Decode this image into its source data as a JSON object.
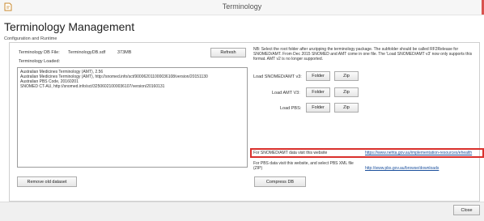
{
  "window": {
    "title": "Terminology",
    "accent_color": "#d9534f"
  },
  "page": {
    "title": "Terminology Management",
    "section_label": "Configuration and Runtime"
  },
  "db": {
    "file_label": "Terminology DB File:",
    "file_name": "TerminologyDB.sdf",
    "file_size": "373MB",
    "refresh_label": "Refresh",
    "loaded_label": "Terminology Loaded:"
  },
  "loaded_items": [
    "Australian Medicines Terminology (AMT), 2.56",
    "Australian Medicines Terminology (AMT), http://snomed.info/sct/900062011000036108/version/20151130",
    "Australian PBS Code, 20160201",
    "SNOMED CT-AU, http://snomed.info/sct/32506021000036107/version/20160131"
  ],
  "note": "NB: Select the root folder after unzipping the terminology package. The subfolder should be called RF2Release for SNOMED/AMT. From Dec 2015 SNOMED and AMT come in one file. The 'Load SNOMED/AMT v3' now only supports this format. AMT v2 is no longer supported.",
  "loaders": [
    {
      "label": "Load SNOMED/AMT v3:",
      "folder": "Folder",
      "zip": "Zip"
    },
    {
      "label": "Load AMT V3:",
      "folder": "Folder",
      "zip": "Zip"
    },
    {
      "label": "Load PBS:",
      "folder": "Folder",
      "zip": "Zip"
    }
  ],
  "snomed_info": {
    "text": "For SNOMED/AMT data visit this website",
    "link": "https://www.nehta.gov.au/implementation-resources/ehealth",
    "highlight_color": "#d9302c"
  },
  "pbs_info": {
    "text": "For PBS data visit this website, and select PBS XML file (ZIP)",
    "link": "http://www.pbs.gov.au/browse/downloads"
  },
  "actions": {
    "remove_label": "Remove old dataset",
    "compress_label": "Compress DB"
  },
  "footer": {
    "close_label": "Close"
  }
}
